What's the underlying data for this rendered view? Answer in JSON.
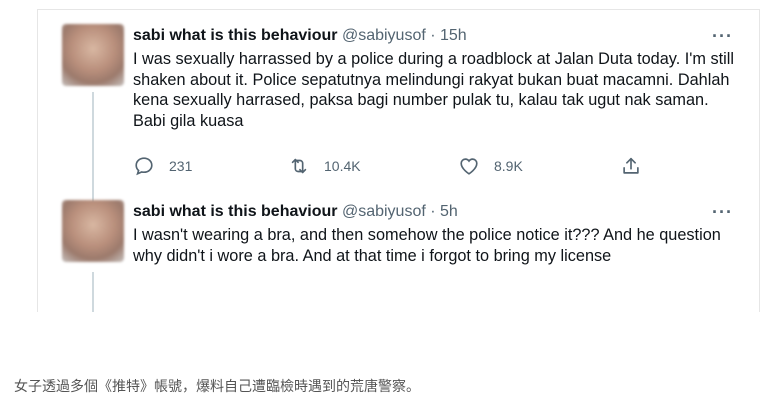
{
  "tweet1": {
    "display_name": "sabi what is this behaviour",
    "handle_time": "@sabiyusof · 15h",
    "more": "···",
    "text": "I was sexually harrassed by a police during a roadblock at Jalan Duta today. I'm still shaken about it. Police sepatutnya melindungi rakyat bukan buat macamni. Dahlah kena sexually harrased, paksa bagi number pulak tu, kalau tak ugut nak saman. Babi gila kuasa",
    "reply_count": "231",
    "retweet_count": "10.4K",
    "like_count": "8.9K"
  },
  "tweet2": {
    "display_name": "sabi what is this behaviour",
    "handle_time": "@sabiyusof · 5h",
    "more": "···",
    "text": "I wasn't wearing a bra, and then somehow the police notice it??? And he question why didn't i wore a bra. And at that time i forgot to bring my license"
  },
  "caption": "女子透過多個《推特》帳號，爆料自己遭臨檢時遇到的荒唐警察。",
  "colors": {
    "text": "#0f1419",
    "muted": "#536471",
    "thread_line": "#cfd9de"
  },
  "icons": [
    "reply-icon",
    "retweet-icon",
    "like-icon",
    "share-icon",
    "more-icon"
  ]
}
